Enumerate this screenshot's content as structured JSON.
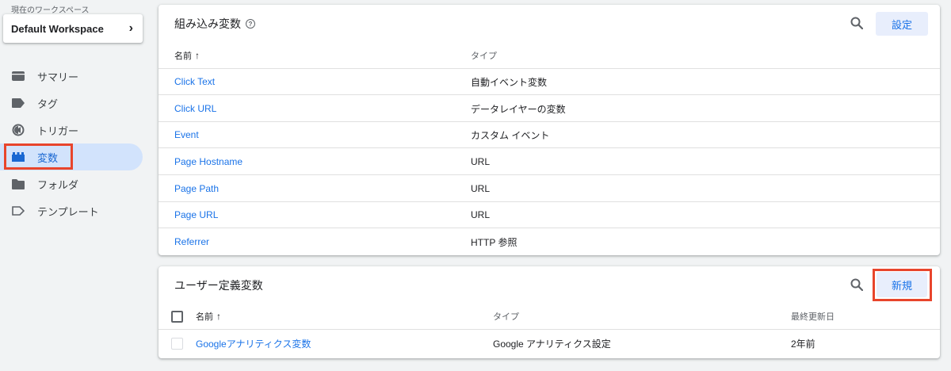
{
  "workspace": {
    "caption": "現在のワークスペース",
    "name": "Default Workspace"
  },
  "nav": [
    {
      "label": "サマリー",
      "icon": "summary-icon"
    },
    {
      "label": "タグ",
      "icon": "tag-icon"
    },
    {
      "label": "トリガー",
      "icon": "trigger-icon"
    },
    {
      "label": "変数",
      "icon": "variables-icon",
      "active": true
    },
    {
      "label": "フォルダ",
      "icon": "folder-icon"
    },
    {
      "label": "テンプレート",
      "icon": "template-icon"
    }
  ],
  "builtin": {
    "title": "組み込み変数",
    "configure_label": "設定",
    "col_name": "名前",
    "col_type": "タイプ",
    "rows": [
      {
        "name": "Click Text",
        "type": "自動イベント変数"
      },
      {
        "name": "Click URL",
        "type": "データレイヤーの変数"
      },
      {
        "name": "Event",
        "type": "カスタム イベント"
      },
      {
        "name": "Page Hostname",
        "type": "URL"
      },
      {
        "name": "Page Path",
        "type": "URL"
      },
      {
        "name": "Page URL",
        "type": "URL"
      },
      {
        "name": "Referrer",
        "type": "HTTP 参照"
      }
    ]
  },
  "user_defined": {
    "title": "ユーザー定義変数",
    "new_label": "新規",
    "col_name": "名前",
    "col_type": "タイプ",
    "col_updated": "最終更新日",
    "rows": [
      {
        "name": "Googleアナリティクス変数",
        "type": "Google アナリティクス設定",
        "updated": "2年前"
      }
    ]
  },
  "colors": {
    "accent": "#1a73e8",
    "active_bg": "#d2e3fc",
    "highlight": "#e8452c"
  }
}
